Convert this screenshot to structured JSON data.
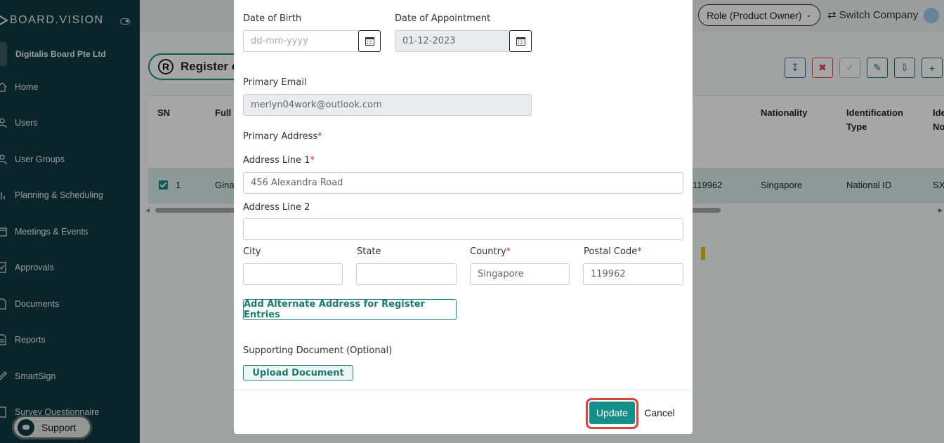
{
  "brand": {
    "name": "BOARD.VISION"
  },
  "sidebar": {
    "company": "Digitalis Board Pte Ltd",
    "items": [
      {
        "label": "Home",
        "icon": "home-icon"
      },
      {
        "label": "Users",
        "icon": "user-icon"
      },
      {
        "label": "User Groups",
        "icon": "users-icon"
      },
      {
        "label": "Planning & Scheduling",
        "icon": "chart-icon"
      },
      {
        "label": "Meetings & Events",
        "icon": "calendar-icon"
      },
      {
        "label": "Approvals",
        "icon": "approval-icon"
      },
      {
        "label": "Documents",
        "icon": "document-icon"
      },
      {
        "label": "Reports",
        "icon": "report-icon"
      },
      {
        "label": "SmartSign",
        "icon": "pen-icon"
      },
      {
        "label": "Survey Questionnaire",
        "icon": "survey-icon"
      }
    ],
    "support_label": "Support"
  },
  "header": {
    "role_label": "Role (Product Owner)",
    "switch_label": "Switch Company"
  },
  "register": {
    "title": "Register o",
    "badge": "R",
    "columns": [
      "SN",
      "Full",
      "Nationality",
      "Identification Type",
      "Ide No"
    ],
    "row": {
      "sn": "1",
      "full": "Gina",
      "postal": "119962",
      "nationality": "Singapore",
      "id_type": "National ID",
      "id_no": "SX"
    }
  },
  "modal": {
    "dob": {
      "label": "Date of Birth",
      "placeholder": "dd-mm-yyyy"
    },
    "doa": {
      "label": "Date of Appointment",
      "value": "01-12-2023"
    },
    "email": {
      "label": "Primary Email",
      "value": "merlyn04work@outlook.com"
    },
    "address_heading": "Primary Address",
    "line1": {
      "label": "Address Line 1",
      "value": "456 Alexandra Road"
    },
    "line2": {
      "label": "Address Line 2",
      "value": ""
    },
    "city": {
      "label": "City",
      "value": ""
    },
    "state": {
      "label": "State",
      "value": ""
    },
    "country": {
      "label": "Country",
      "value": "Singapore"
    },
    "postal": {
      "label": "Postal Code",
      "value": "119962"
    },
    "alt_address_button": "Add Alternate Address for Register Entries",
    "supporting_label": "Supporting Document (Optional)",
    "upload_button": "Upload Document",
    "update_button": "Update",
    "cancel_button": "Cancel",
    "required_mark": "*"
  },
  "colors": {
    "accent": "#148f8a",
    "sidebar": "#0f3a3f",
    "danger": "#d9453a"
  }
}
